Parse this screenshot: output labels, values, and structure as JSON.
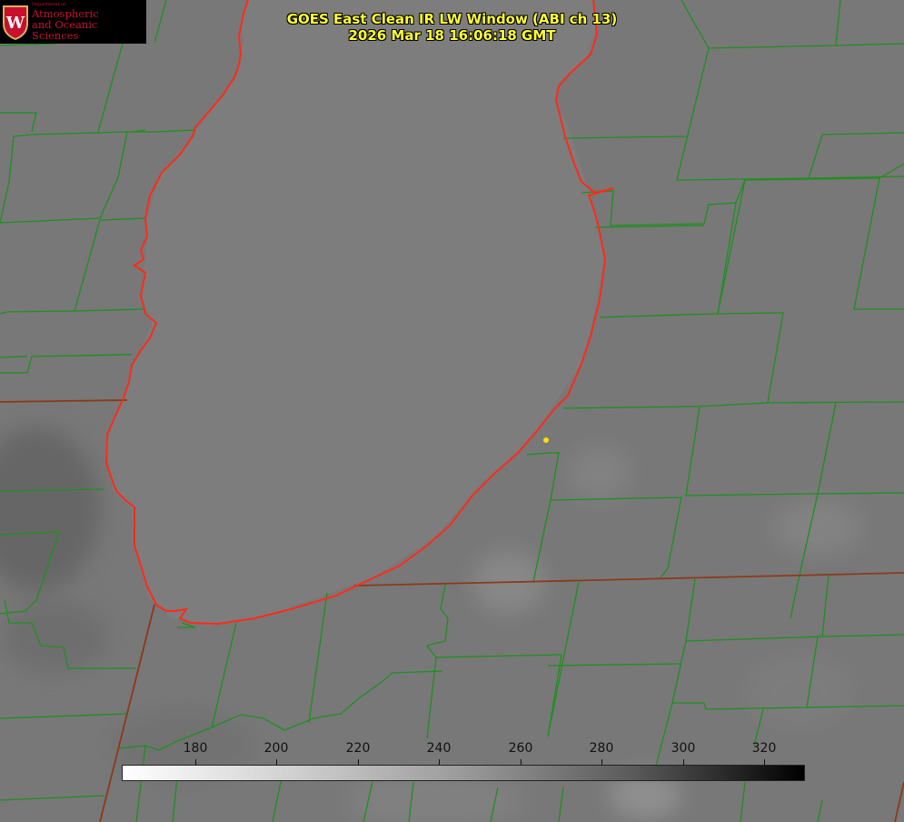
{
  "title": {
    "line1": "GOES East Clean IR LW Window (ABI ch 13)",
    "line2": "2026 Mar 18 16:06:18 GMT"
  },
  "logo": {
    "dept": "Department of",
    "line1": "Atmospheric",
    "line2": "and Oceanic Sciences",
    "seal_letter": "W"
  },
  "colorbar": {
    "tick_labels": [
      "180",
      "200",
      "220",
      "240",
      "260",
      "280",
      "300",
      "320"
    ]
  },
  "colors": {
    "county_lines": "#1f8f1f",
    "state_lines": "#8b3a1a",
    "coastline": "#ff2a1a",
    "marker": "#ffdd00",
    "title": "#ffff33",
    "logo_red": "#c8102e"
  }
}
